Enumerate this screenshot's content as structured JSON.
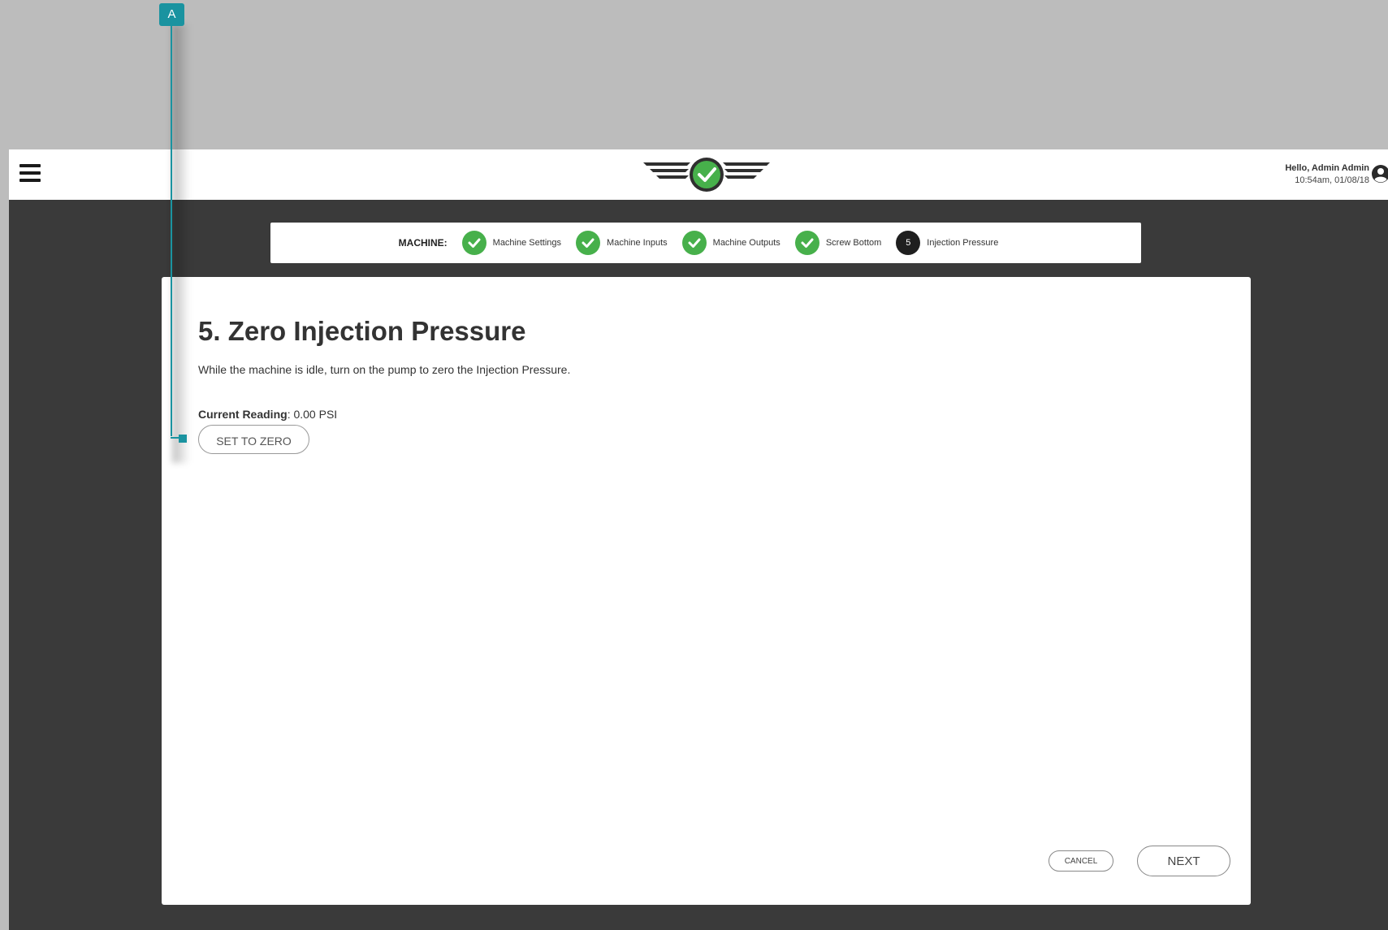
{
  "header": {
    "greeting": "Hello, Admin Admin",
    "timestamp": "10:54am, 01/08/18",
    "menu_icon": "hamburger-menu-icon",
    "logo_icon": "wings-check-logo",
    "user_icon": "user-circle-icon"
  },
  "stepper": {
    "label": "MACHINE:",
    "steps": [
      {
        "label": "Machine Settings",
        "status": "complete"
      },
      {
        "label": "Machine Inputs",
        "status": "complete"
      },
      {
        "label": "Machine Outputs",
        "status": "complete"
      },
      {
        "label": "Screw Bottom",
        "status": "complete"
      },
      {
        "label": "Injection Pressure",
        "status": "current",
        "number": "5"
      }
    ]
  },
  "main": {
    "title": "5. Zero Injection Pressure",
    "description": "While the machine is idle, turn on the pump to zero the Injection Pressure.",
    "reading_label": "Current Reading",
    "reading_value": ": 0.00 PSI",
    "set_zero_label": "SET TO ZERO"
  },
  "footer": {
    "cancel_label": "CANCEL",
    "next_label": "NEXT"
  },
  "callout": {
    "letter": "A"
  },
  "colors": {
    "accent_green": "#47b04b",
    "callout_teal": "#1a93a0",
    "dark_bg": "#3a3a3a"
  }
}
